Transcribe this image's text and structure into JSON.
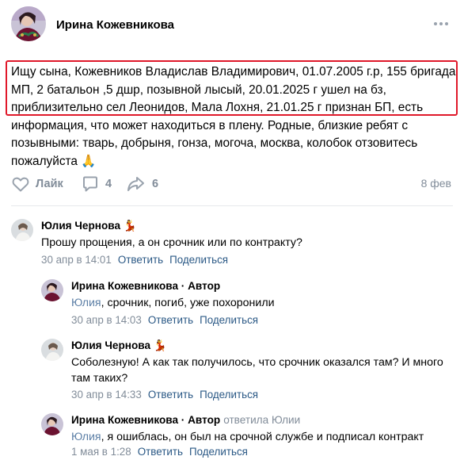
{
  "post": {
    "author": "Ирина Кожевникова",
    "text": "Ищу сына, Кожевников Владислав Владимирович, 01.07.2005 г.р, 155 бригада МП, 2 батальон ,5 дшр, позывной лысый, 20.01.2025 г ушел на бз, приблизительно сел Леонидов, Мала Лохня, 21.01.25 г признан БП, есть информация, что может находиться в плену. Родные, близкие ребят с позывными: тварь, добрыня, гонза, могоча, москва, колобок отзовитесь пожалуйста 🙏",
    "like_label": "Лайк",
    "comments_count": "4",
    "shares_count": "6",
    "date": "8 фев"
  },
  "comments": [
    {
      "author": "Юлия Чернова",
      "author_suffix": "💃",
      "role": "",
      "replied": "",
      "text": "Прошу прощения, а он срочник или по контракту?",
      "addressee": "",
      "date": "30 апр в 14:01",
      "reply_label": "Ответить",
      "share_label": "Поделиться"
    },
    {
      "author": "Ирина Кожевникова",
      "author_suffix": "",
      "role": " · Автор",
      "replied": "",
      "text": ", срочник, погиб, уже похоронили",
      "addressee": "Юлия",
      "date": "30 апр в 14:03",
      "reply_label": "Ответить",
      "share_label": "Поделиться"
    },
    {
      "author": "Юлия Чернова",
      "author_suffix": "💃",
      "role": "",
      "replied": "",
      "text_lines": [
        "Соболезную! А как так получилось, что срочник оказался там? И много",
        "там таких?"
      ],
      "date": "30 апр в 14:33",
      "reply_label": "Ответить",
      "share_label": "Поделиться"
    },
    {
      "author": "Ирина Кожевникова",
      "author_suffix": "",
      "role": " · Автор",
      "replied": "ответила Юлии",
      "text": ", я ошиблась, он был на срочной службе и подписал контракт",
      "addressee": "Юлия",
      "date": "1 мая в 1:28",
      "reply_label": "Ответить",
      "share_label": "Поделиться"
    }
  ],
  "colors": {
    "highlight": "#e0182a",
    "muted": "#818c99",
    "link": "#2a5885",
    "addressee": "#5c7fa6"
  },
  "icons": [
    "more-icon",
    "heart-icon",
    "comment-icon",
    "share-icon"
  ]
}
